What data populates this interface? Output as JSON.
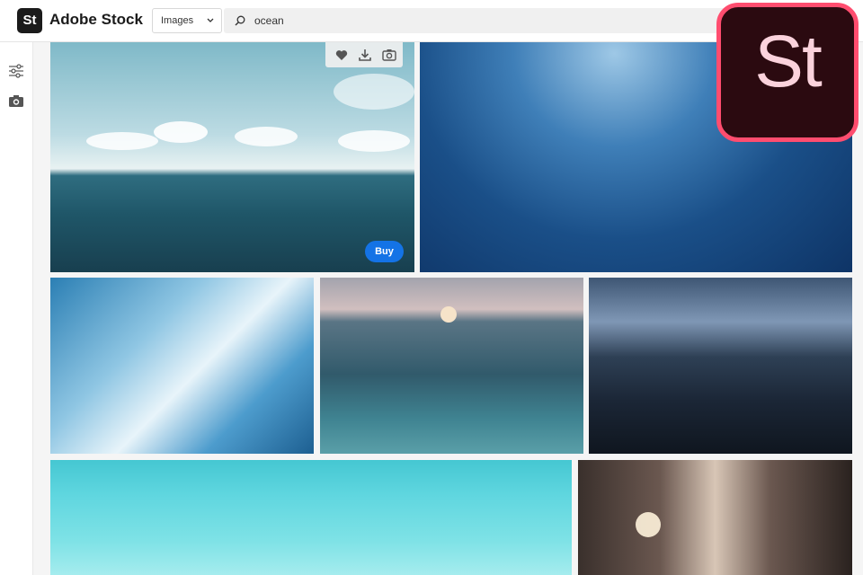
{
  "header": {
    "logo_text": "St",
    "brand": "Adobe Stock",
    "asset_type": "Images",
    "search_query": "ocean"
  },
  "icons": {
    "chevron": "chevron-down-icon",
    "search": "search-icon",
    "filter": "filter-sliders-icon",
    "camera": "camera-icon",
    "heart": "heart-icon",
    "download": "download-icon"
  },
  "tile_overlay": {
    "buy_label": "Buy"
  },
  "app_badge": {
    "text": "St"
  },
  "colors": {
    "accent_blue": "#1473e6",
    "badge_border": "#ff4d6f",
    "badge_bg": "#2b0a10",
    "badge_text": "#fbd2dc"
  },
  "results": [
    {
      "subject": "ocean horizon with clouds"
    },
    {
      "subject": "underwater sun rays"
    },
    {
      "subject": "aerial waves foam"
    },
    {
      "subject": "sunset over sea"
    },
    {
      "subject": "stormy dark sea"
    },
    {
      "subject": "turquoise water"
    },
    {
      "subject": "rocky sea cliffs"
    }
  ]
}
